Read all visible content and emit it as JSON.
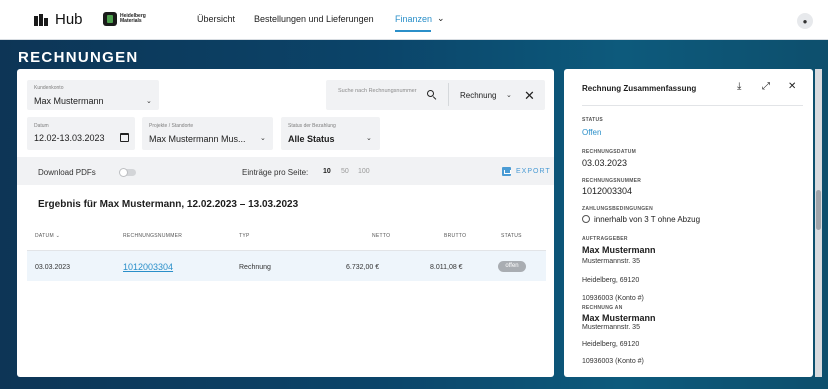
{
  "nav": {
    "hub_label": "Hub",
    "partner_logo_line1": "Heidelberg",
    "partner_logo_line2": "Materials",
    "items": [
      {
        "label": "Übersicht"
      },
      {
        "label": "Bestellungen und Lieferungen"
      },
      {
        "label": "Finanzen"
      }
    ],
    "user_icon": "user-icon"
  },
  "page": {
    "title": "RECHNUNGEN"
  },
  "filters": {
    "customer_account": {
      "label": "Kundenkonto",
      "value": "Max Mustermann"
    },
    "search": {
      "placeholder": "Suche nach Rechnungsnummer",
      "type_value": "Rechnung"
    },
    "date": {
      "label": "Datum",
      "value": "12.02-13.03.2023"
    },
    "project": {
      "label": "Projekte / Standorte",
      "value": "Max Mustermann Mus..."
    },
    "payment_status": {
      "label": "Status der Bezahlung",
      "value": "Alle Status"
    }
  },
  "toolbar": {
    "download_pdfs_label": "Download PDFs",
    "download_pdfs_enabled": false,
    "entries_per_page_label": "Einträge pro Seite:",
    "page_sizes": [
      "10",
      "50",
      "100"
    ],
    "page_size_selected": "10",
    "export_label": "EXPORT"
  },
  "results": {
    "heading": "Ergebnis für Max Mustermann, 12.02.2023 – 13.03.2023",
    "columns": {
      "date": "DATUM",
      "invoice_number": "RECHNUNGSNUMMER",
      "type": "TYP",
      "net": "NETTO",
      "gross": "BRUTTO",
      "status": "STATUS"
    },
    "rows": [
      {
        "date": "03.03.2023",
        "invoice_number": "1012003304",
        "type": "Rechnung",
        "net": "6.732,00 €",
        "gross": "8.011,08 €",
        "status": "offen"
      }
    ]
  },
  "summary": {
    "title": "Rechnung Zusammenfassung",
    "status_label": "STATUS",
    "status_value": "Offen",
    "date_label": "RECHNUNGSDATUM",
    "date_value": "03.03.2023",
    "number_label": "RECHNUNGSNUMMER",
    "number_value": "1012003304",
    "terms_label": "ZAHLUNGSBEDINGUNGEN",
    "terms_value": "innerhalb von 3 T ohne Abzug",
    "client_label": "AUFTRAGGEBER",
    "client_name": "Max Mustermann",
    "client_street": "Mustermannstr. 35",
    "client_city": "Heidelberg, 69120",
    "client_account": "10936003 (Konto #)",
    "bill_to_label": "RECHNUNG AN",
    "bill_to_name": "Max Mustermann",
    "bill_to_street": "Mustermannstr. 35",
    "bill_to_city": "Heidelberg, 69120",
    "bill_to_account": "10936003 (Konto #)"
  },
  "colors": {
    "accent": "#2a8fc9",
    "banner": "#0b4469",
    "status_badge": "#a9adb2"
  }
}
